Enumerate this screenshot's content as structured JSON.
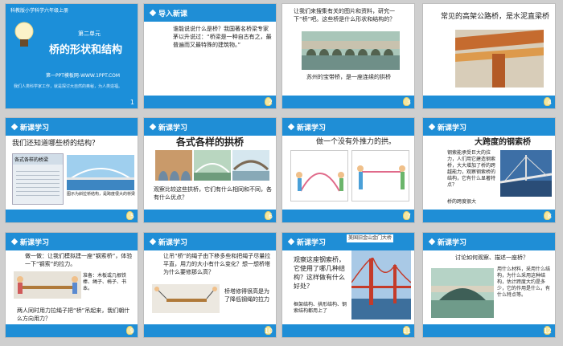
{
  "slides": [
    {
      "number": "1",
      "subtitle": "科教版小学科学六年级上册",
      "unit": "第二单元",
      "title": "桥的形状和结构",
      "site": "第一PPT模板网-WWW.1PPT.COM",
      "note": "我们人类科学家工作，就是探讨大自然的奥秘，为人类造福。"
    },
    {
      "number": "2",
      "tag": "导入新课",
      "text": "谁能说说什么是桥？我国著名桥梁专家茅以升说过：“桥梁是一种自古有之，最普遍而又最特殊的建筑物。”"
    },
    {
      "number": "3",
      "text": "让我们来搜集有关的图片和资料，研究一下“桥”吧。这些桥是什么形状和结构的？",
      "caption": "苏州的宝带桥，是一座连续的拱桥"
    },
    {
      "number": "4",
      "title": "常见的高架公路桥，是水泥直梁桥"
    },
    {
      "number": "5",
      "tag": "新课学习",
      "title": "我们还知道哪些桥的结构？",
      "box_title": "各式各样的桥梁",
      "caption": "图示为斜拉桥结构，是跨度很大的桥梁"
    },
    {
      "number": "6",
      "tag": "新课学习",
      "title": "各式各样的拱桥",
      "text": "观察比较这些拱桥，它们有什么相同和不同，各有什么优点？"
    },
    {
      "number": "7",
      "tag": "新课学习",
      "title": "做一个没有外推力的拱。"
    },
    {
      "number": "8",
      "tag": "新课学习",
      "title": "大跨度的钢索桥",
      "text": "钢索能承受巨大的拉力，人们用它建造钢索桥，大大增加了桥的跨越能力，观察钢索桥的结构，它有什么显著特点？",
      "caption": "桥的跨度很大"
    },
    {
      "number": "9",
      "tag": "新课学习",
      "text": "做一做：让我们模拟建一座“钢索桥”，体验一下“钢索”的拉力。",
      "prep": "准备：木板或几根铁棒、绳子、椅子、书本。",
      "question": "两人同时用力拉绳子把“桥”吊起来，我们朝什么方向用力？"
    },
    {
      "number": "10",
      "tag": "新课学习",
      "text": "让吊“桥”的绳子由下移多些和把绳子尽量拉平直，用力的大小有什么变化？想一想桥塔为什么要修那么高？",
      "note": "桥塔修得很高是为了降低钢绳的拉力"
    },
    {
      "number": "11",
      "tag": "新课学习",
      "photo_label": "美国旧金山金门大桥",
      "text": "观察这座钢索桥，它使用了哪几种结构？这样做有什么好处？",
      "answer": "框架结构、拱形结构、钢索结构都用上了"
    },
    {
      "number": "12",
      "tag": "新课学习",
      "text": "讨论如何观察、描述一座桥？",
      "text2": "用什么材料，采用什么结构，为什么采用这种结构，估计跨度大约是多少，它的作用是什么，有什么特点等。"
    }
  ],
  "colors": {
    "header": "#1f8ed6",
    "title_red": "#c0392b"
  }
}
